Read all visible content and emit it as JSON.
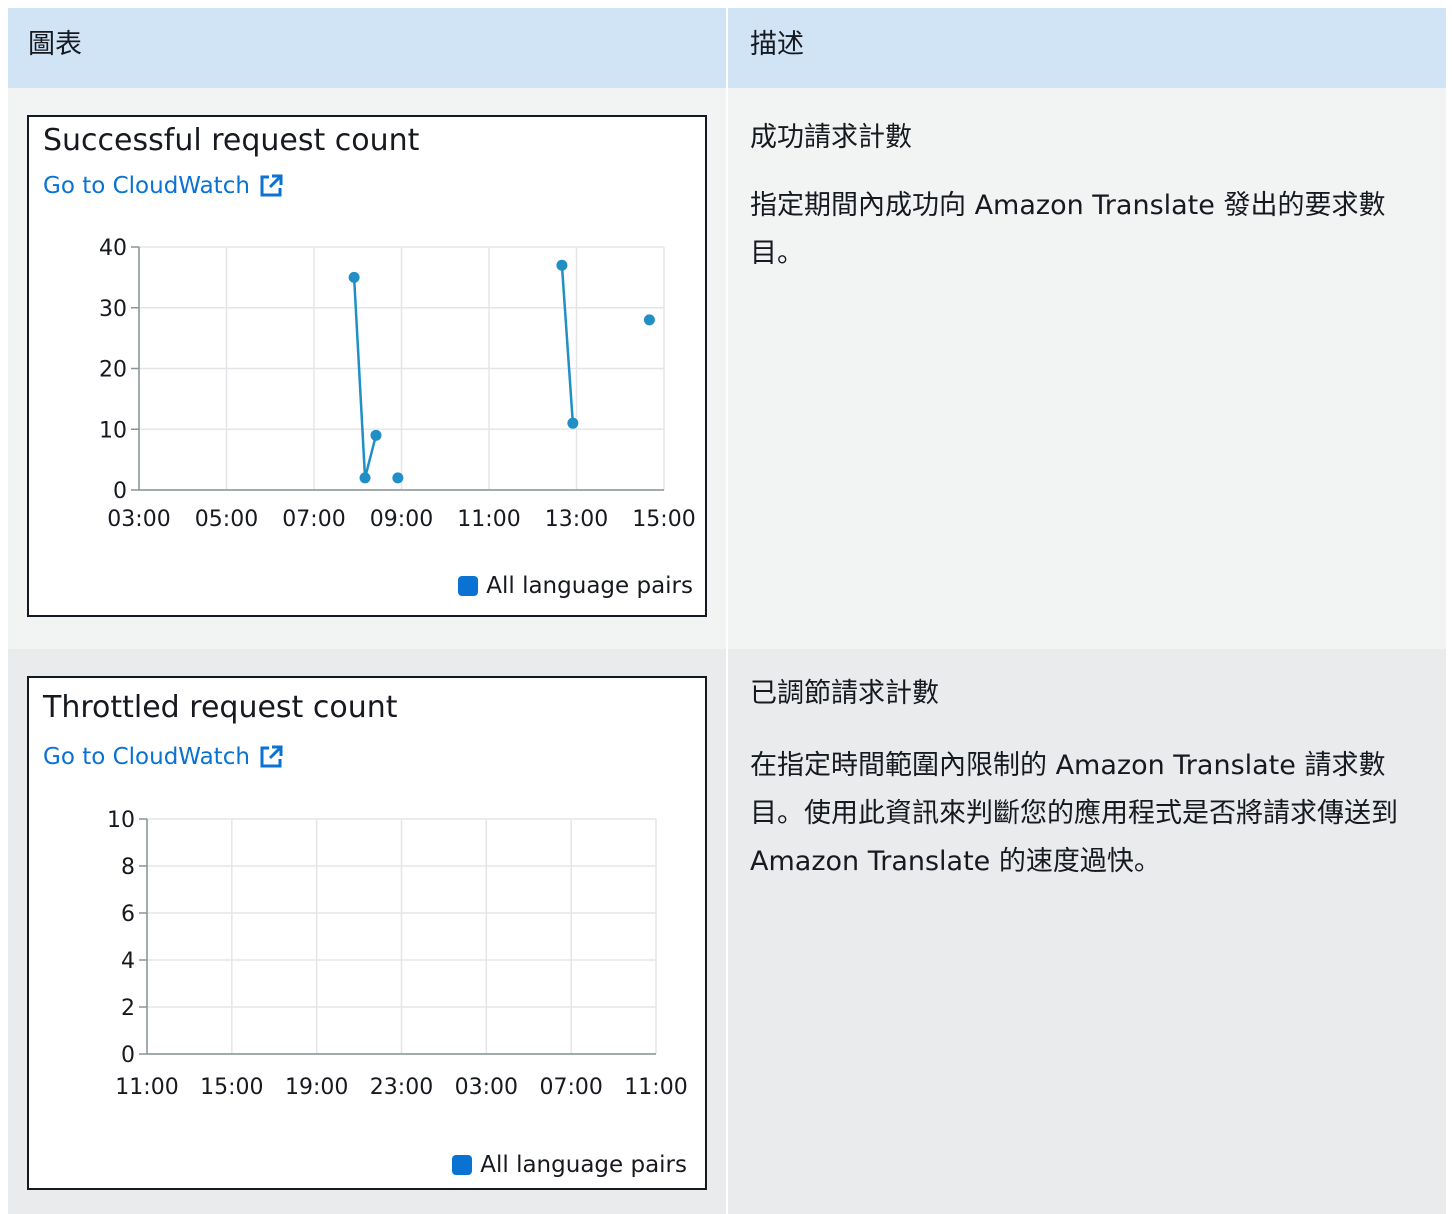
{
  "table": {
    "headers": {
      "chart": "圖表",
      "description": "描述"
    },
    "rows": [
      {
        "desc_title": "成功請求計數",
        "desc_body": "指定期間內成功向 Amazon Translate 發出的要求數目。"
      },
      {
        "desc_title": "已調節請求計數",
        "desc_body": "在指定時間範圍內限制的 Amazon Translate 請求數目。使用此資訊來判斷您的應用程式是否將請求傳送到 Amazon Translate 的速度過快。"
      }
    ]
  },
  "link_label": "Go to CloudWatch",
  "colors": {
    "series": "#1f8fc6",
    "link": "#0972d3",
    "header_bg": "#d1e4f5"
  },
  "chart_data": [
    {
      "type": "line",
      "title": "Successful request count",
      "x_ticks": [
        "03:00",
        "05:00",
        "07:00",
        "09:00",
        "11:00",
        "13:00",
        "15:00"
      ],
      "y_ticks": [
        "0",
        "10",
        "20",
        "30",
        "40"
      ],
      "ylim": [
        0,
        40
      ],
      "grid": true,
      "legend": "bottom-right",
      "series": [
        {
          "name": "All language pairs",
          "segments": [
            [
              {
                "x": "07:55",
                "y": 35
              },
              {
                "x": "08:10",
                "y": 2
              },
              {
                "x": "08:25",
                "y": 9
              }
            ],
            [
              {
                "x": "08:55",
                "y": 2
              }
            ],
            [
              {
                "x": "12:40",
                "y": 37
              },
              {
                "x": "12:55",
                "y": 11
              }
            ],
            [
              {
                "x": "14:40",
                "y": 28
              }
            ]
          ]
        }
      ]
    },
    {
      "type": "line",
      "title": "Throttled request count",
      "x_ticks": [
        "11:00",
        "15:00",
        "19:00",
        "23:00",
        "03:00",
        "07:00",
        "11:00"
      ],
      "y_ticks": [
        "0",
        "2",
        "4",
        "6",
        "8",
        "10"
      ],
      "ylim": [
        0,
        10
      ],
      "grid": true,
      "legend": "bottom-right",
      "series": [
        {
          "name": "All language pairs",
          "segments": []
        }
      ]
    }
  ]
}
